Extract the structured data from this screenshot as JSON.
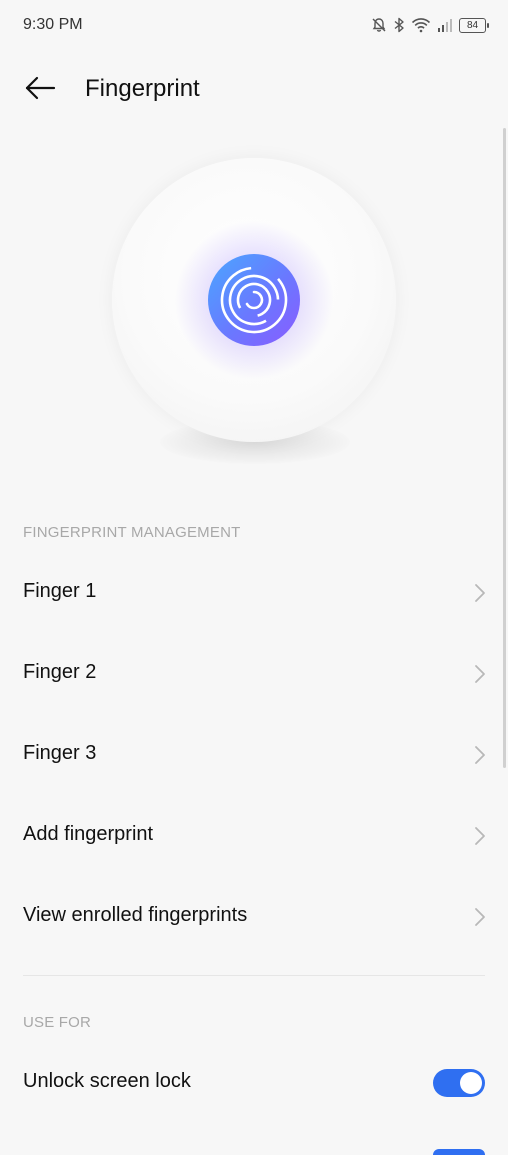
{
  "status_bar": {
    "time": "9:30 PM",
    "battery": "84",
    "icons": [
      "bell-off-icon",
      "bluetooth-icon",
      "wifi-icon",
      "signal-icon",
      "battery-icon"
    ]
  },
  "header": {
    "title": "Fingerprint",
    "back_icon": "arrow-left-icon"
  },
  "hero": {
    "icon": "fingerprint-icon"
  },
  "management": {
    "section_title": "FINGERPRINT MANAGEMENT",
    "items": [
      {
        "label": "Finger 1"
      },
      {
        "label": "Finger 2"
      },
      {
        "label": "Finger 3"
      },
      {
        "label": "Add fingerprint"
      },
      {
        "label": "View enrolled fingerprints"
      }
    ]
  },
  "use_for": {
    "section_title": "USE FOR",
    "items": [
      {
        "label": "Unlock screen lock",
        "enabled": true
      }
    ]
  },
  "colors": {
    "accent": "#2f6ff1",
    "fingerprint_gradient_start": "#7c5cff",
    "fingerprint_gradient_end": "#4aa7ff"
  }
}
